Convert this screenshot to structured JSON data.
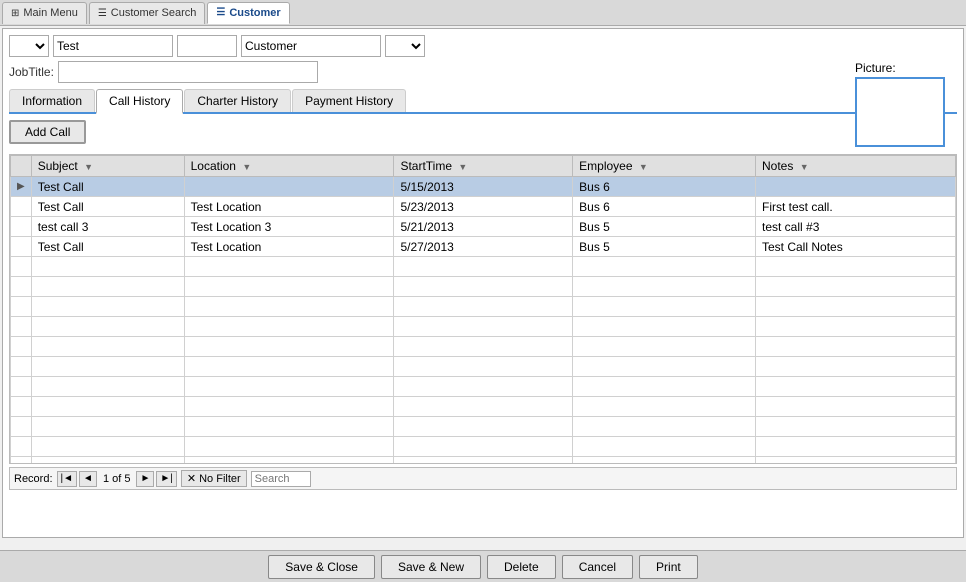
{
  "titlebar": {
    "tabs": [
      {
        "id": "main-menu",
        "label": "Main Menu",
        "icon": "⊞",
        "active": false
      },
      {
        "id": "customer-search",
        "label": "Customer Search",
        "icon": "☰",
        "active": false
      },
      {
        "id": "customer",
        "label": "Customer",
        "icon": "☰",
        "active": true
      }
    ]
  },
  "header": {
    "prefix_placeholder": "",
    "first_name": "Test",
    "last_name_placeholder": "",
    "customer_type": "Customer",
    "suffix_placeholder": "",
    "job_title_label": "JobTitle:",
    "job_title_value": "",
    "picture_label": "Picture:"
  },
  "inner_tabs": [
    {
      "id": "information",
      "label": "Information",
      "active": false
    },
    {
      "id": "call-history",
      "label": "Call History",
      "active": true
    },
    {
      "id": "charter-history",
      "label": "Charter History",
      "active": false
    },
    {
      "id": "payment-history",
      "label": "Payment History",
      "active": false
    }
  ],
  "call_history": {
    "add_call_label": "Add Call",
    "columns": [
      {
        "id": "subject",
        "label": "Subject"
      },
      {
        "id": "location",
        "label": "Location"
      },
      {
        "id": "start_time",
        "label": "StartTime"
      },
      {
        "id": "employee",
        "label": "Employee"
      },
      {
        "id": "notes",
        "label": "Notes"
      }
    ],
    "rows": [
      {
        "id": 1,
        "subject": "Test Call",
        "location": "",
        "start_time": "5/15/2013",
        "employee": "Bus 6",
        "notes": "",
        "selected": true
      },
      {
        "id": 2,
        "subject": "Test Call",
        "location": "Test Location",
        "start_time": "5/23/2013",
        "employee": "Bus 6",
        "notes": "First test call.",
        "selected": false
      },
      {
        "id": 3,
        "subject": "test call 3",
        "location": "Test Location 3",
        "start_time": "5/21/2013",
        "employee": "Bus 5",
        "notes": "test call #3",
        "selected": false
      },
      {
        "id": 4,
        "subject": "Test Call",
        "location": "Test Location",
        "start_time": "5/27/2013",
        "employee": "Bus 5",
        "notes": "Test Call Notes",
        "selected": false
      }
    ],
    "empty_rows": 10
  },
  "status_bar": {
    "record_label": "Record:",
    "current": "1",
    "total": "5",
    "no_filter_label": "No Filter",
    "search_placeholder": "Search"
  },
  "bottom_buttons": [
    {
      "id": "save-close",
      "label": "Save & Close"
    },
    {
      "id": "save-new",
      "label": "Save & New"
    },
    {
      "id": "delete",
      "label": "Delete"
    },
    {
      "id": "cancel",
      "label": "Cancel"
    },
    {
      "id": "print",
      "label": "Print"
    }
  ]
}
